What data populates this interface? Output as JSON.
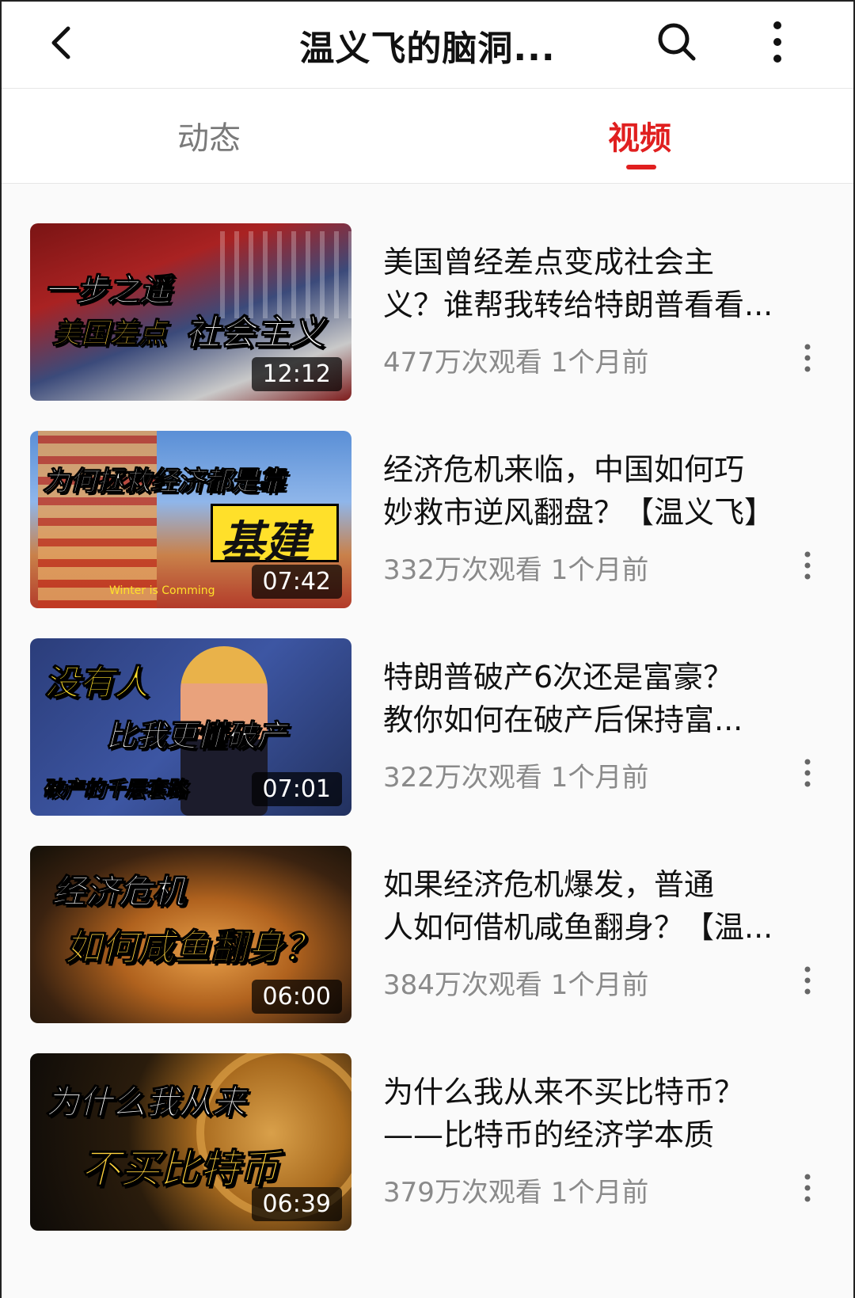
{
  "header": {
    "title": "温义飞的脑洞...",
    "back_icon": "chevron-left-icon",
    "search_icon": "search-icon",
    "more_icon": "more-vertical-icon"
  },
  "tabs": [
    {
      "label": "动态",
      "active": false
    },
    {
      "label": "视频",
      "active": true
    }
  ],
  "colors": {
    "accent": "#e01f1f",
    "meta_text": "#8a8a8a"
  },
  "videos": [
    {
      "title_line1": "美国曾经差点变成社会主",
      "title_line2": "义？谁帮我转给特朗普看看...",
      "views": "477万次观看",
      "age": "1个月前",
      "duration": "12:12",
      "thumb_text_1": "一步之遥",
      "thumb_text_2": "美国差点",
      "thumb_text_3": "社会主义"
    },
    {
      "title_line1": "经济危机来临，中国如何巧",
      "title_line2": "妙救市逆风翻盘？【温义飞】",
      "views": "332万次观看",
      "age": "1个月前",
      "duration": "07:42",
      "thumb_text_1": "为何拯救经济都是靠",
      "thumb_text_2": "基建",
      "thumb_text_3": "Winter is Comming"
    },
    {
      "title_line1": "特朗普破产6次还是富豪？",
      "title_line2": "教你如何在破产后保持富...",
      "views": "322万次观看",
      "age": "1个月前",
      "duration": "07:01",
      "thumb_text_1": "没有人",
      "thumb_text_2": "比我更懂破产",
      "thumb_text_3": "破产的千层套路"
    },
    {
      "title_line1": "如果经济危机爆发，普通",
      "title_line2": "人如何借机咸鱼翻身？【温...",
      "views": "384万次观看",
      "age": "1个月前",
      "duration": "06:00",
      "thumb_text_1": "经济危机",
      "thumb_text_2": "如何咸鱼翻身？",
      "thumb_text_3": ""
    },
    {
      "title_line1": "为什么我从来不买比特币？",
      "title_line2": "——比特币的经济学本质",
      "views": "379万次观看",
      "age": "1个月前",
      "duration": "06:39",
      "thumb_text_1": "为什么我从来",
      "thumb_text_2": "不买比特币",
      "thumb_text_3": ""
    }
  ]
}
